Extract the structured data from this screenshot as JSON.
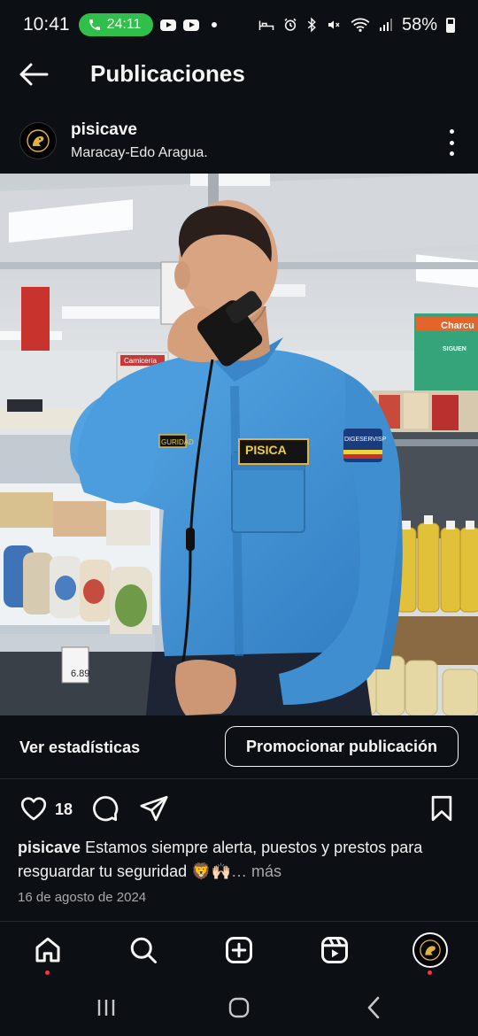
{
  "status_bar": {
    "time": "10:41",
    "call_timer": "24:11",
    "battery_percent": "58%",
    "icons": [
      "phone-icon",
      "youtube-icon",
      "youtube-icon",
      "dot-icon",
      "bed-icon",
      "alarm-icon",
      "bluetooth-icon",
      "mute-icon",
      "wifi-icon",
      "signal-icon",
      "battery-icon"
    ]
  },
  "header": {
    "title": "Publicaciones",
    "back_icon": "arrow-left-icon"
  },
  "post": {
    "username": "pisicave",
    "location": "Maracay-Edo Aragua.",
    "photo_alt": "Guardia de seguridad con uniforme azul hablando por radio en un supermercado",
    "photo_texts": {
      "badge": "PISICA",
      "patch": "DIGESERVISP",
      "tag": "GURIDAD",
      "price": "6.89",
      "store_sign": "Carnicería",
      "promo_sign": "Charcu",
      "promo_small": "SIGUEN"
    }
  },
  "actions": {
    "stats_label": "Ver estadísticas",
    "promote_label": "Promocionar publicación",
    "likes": "18"
  },
  "caption": {
    "user": "pisicave",
    "text": " Estamos siempre alerta, puestos y prestos para resguardar tu seguridad 🦁🙌🏻",
    "more": "… más"
  },
  "date": "16 de agosto de 2024",
  "colors": {
    "background": "#0c1014",
    "call_pill": "#2fbf4a",
    "notification_dot": "#ff3040",
    "uniform": "#3f93d6"
  }
}
